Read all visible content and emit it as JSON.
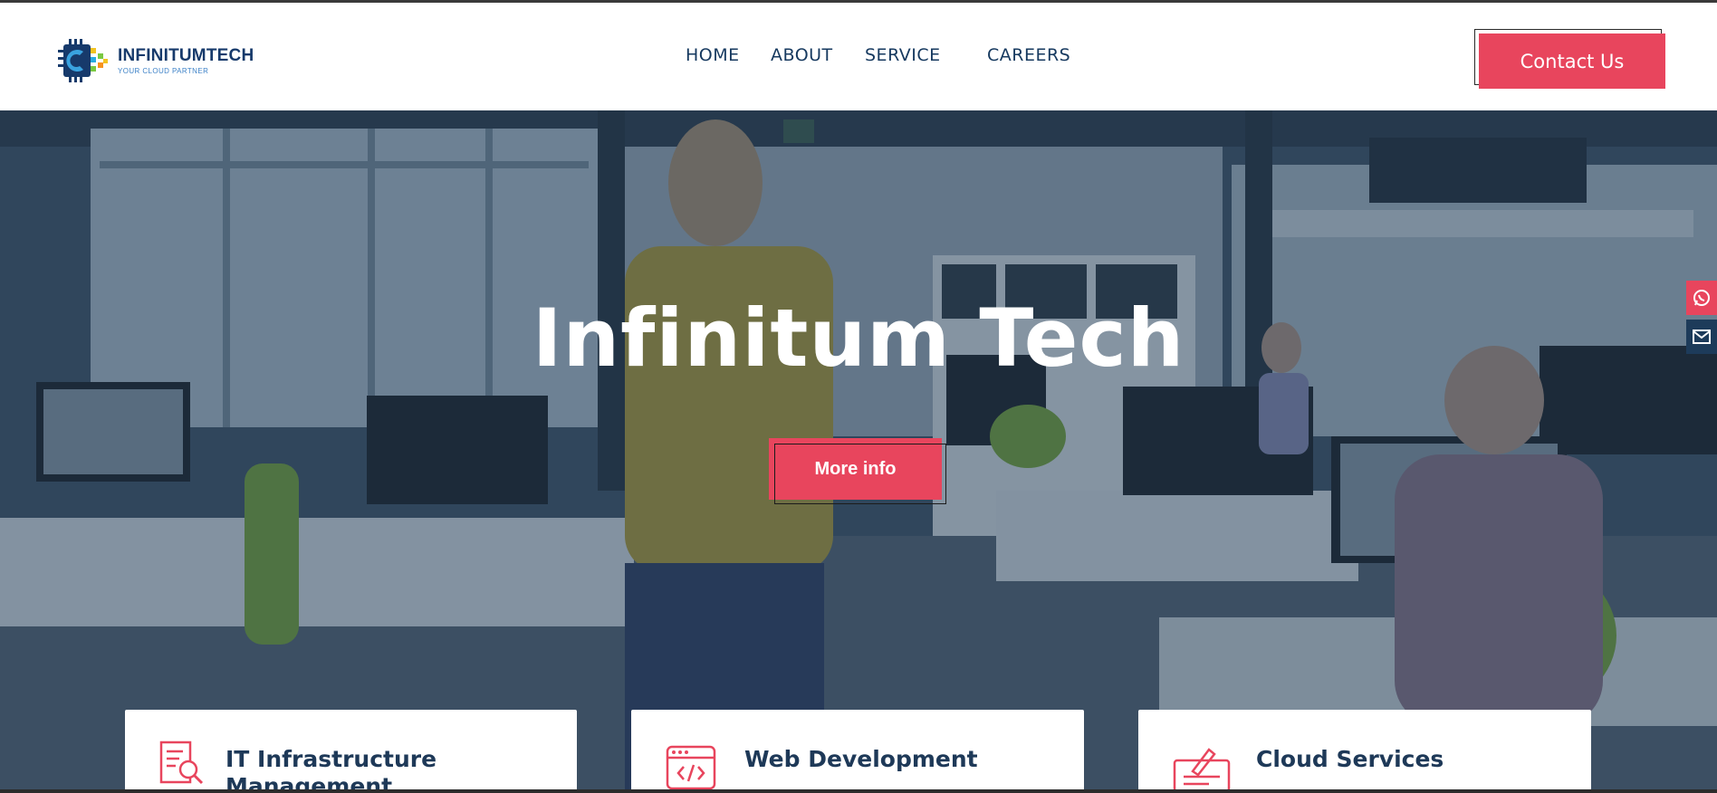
{
  "brand": {
    "name": "INFINITUMTECH",
    "tagline": "YOUR CLOUD PARTNER",
    "logo_icon": "chip-c-logo"
  },
  "nav": {
    "items": [
      {
        "label": "HOME"
      },
      {
        "label": "ABOUT"
      },
      {
        "label": "SERVICE"
      },
      {
        "label": "CAREERS"
      }
    ],
    "contact_label": "Contact Us"
  },
  "hero": {
    "title": "Infinitum Tech",
    "cta_label": "More info"
  },
  "side_icons": [
    "whatsapp-icon",
    "mail-icon"
  ],
  "services": [
    {
      "title": "IT Infrastructure Management",
      "icon": "document-search-icon"
    },
    {
      "title": "Web Development",
      "icon": "browser-code-icon"
    },
    {
      "title": "Cloud Services",
      "icon": "pen-document-icon"
    }
  ],
  "colors": {
    "accent": "#e8455d",
    "navy": "#16395f",
    "overlay": "#1c3450"
  }
}
